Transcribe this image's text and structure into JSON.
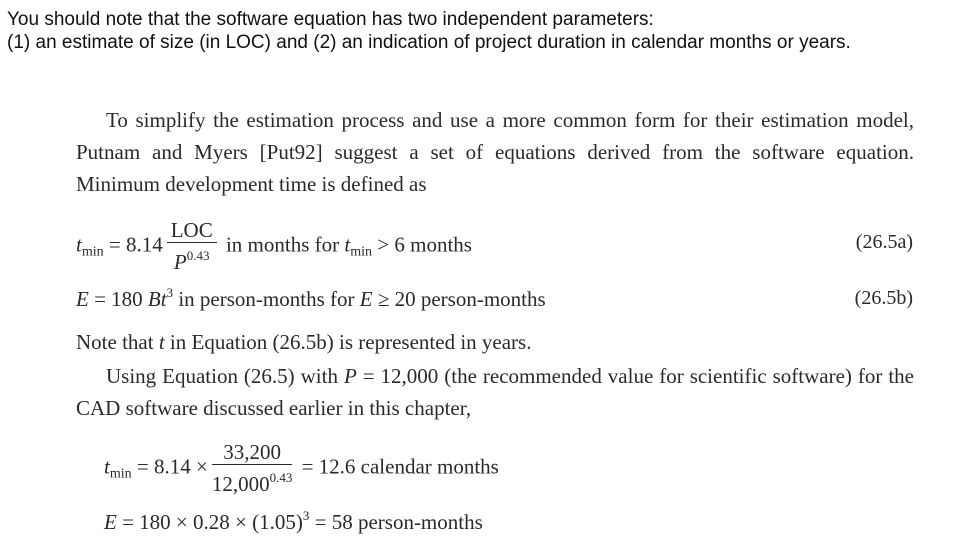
{
  "intro": {
    "line1": "You should note that the software equation has two independent parameters:",
    "line2": "(1) an estimate of size (in LOC) and (2) an indication of project duration in calendar months or years."
  },
  "book": {
    "para1": "To simplify the estimation process and use a more common form for their estimation model, Putnam and Myers [Put92] suggest a set of equations derived from the software equation. Minimum development time is defined as",
    "eq_a": {
      "lhs_var": "t",
      "lhs_sub": "min",
      "equals": "= 8.14",
      "numerator": "LOC",
      "denominator_var": "P",
      "denominator_exp": "0.43",
      "tail_pre": "in months for ",
      "tail_var": "t",
      "tail_sub": "min",
      "tail_post": " > 6 months",
      "number": "(26.5a)"
    },
    "eq_b": {
      "lhs_var": "E",
      "mid": " = 180 ",
      "var_b": "Bt",
      "exp": "3",
      "tail_pre": " in person-months for ",
      "tail_var": "E",
      "tail_post": " ≥ 20 person-months",
      "number": "(26.5b)"
    },
    "para2_pre": "Note that ",
    "para2_var": "t",
    "para2_post": " in Equation (26.5b) is represented in years.",
    "para3_pre": "Using Equation (26.5) with ",
    "para3_var": "P",
    "para3_post": " = 12,000 (the recommended value for scientific software) for the CAD software discussed earlier in this chapter,",
    "calc_a": {
      "lhs_var": "t",
      "lhs_sub": "min",
      "equals": "= 8.14 ×",
      "numerator": "33,200",
      "denominator": "12,000",
      "denominator_exp": "0.43",
      "result": "= 12.6 calendar months"
    },
    "calc_b": {
      "lhs_var": "E",
      "expr": " = 180 × 0.28 × (1.05)",
      "exp": "3",
      "result": " = 58 person-months"
    }
  }
}
